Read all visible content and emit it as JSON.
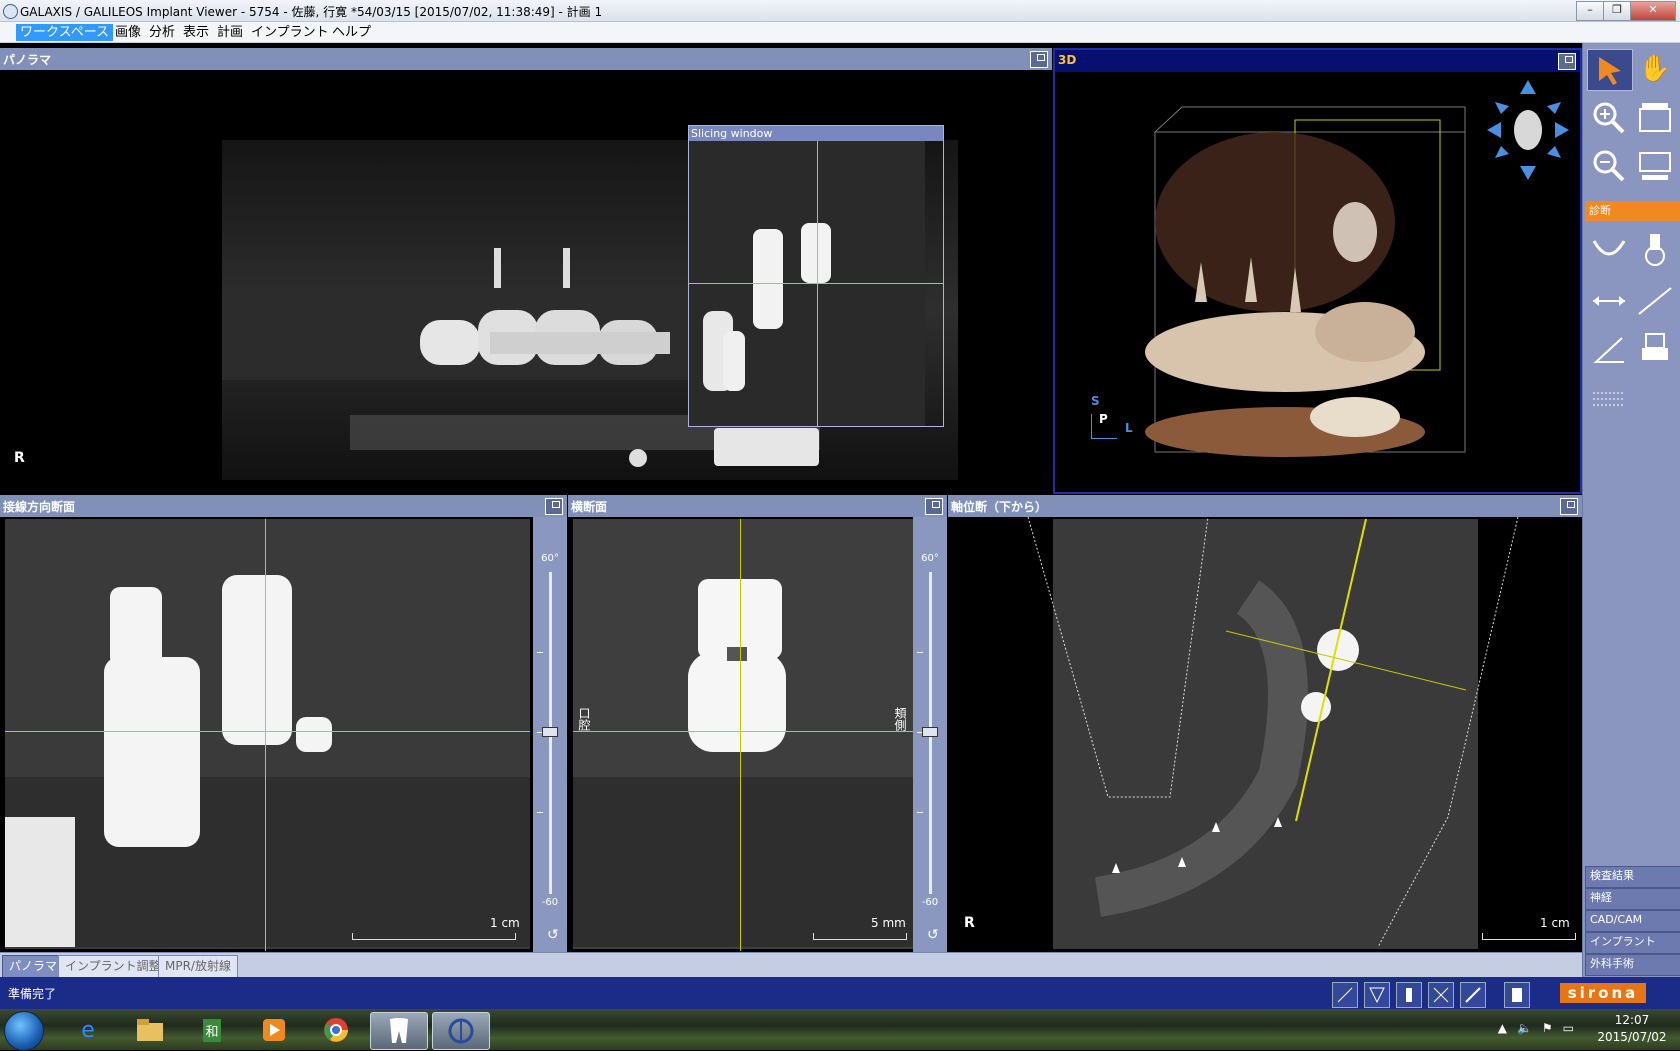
{
  "window": {
    "title": "GALAXIS / GALILEOS Implant Viewer - 5754 - 佐藤, 行寛 *54/03/15 [2015/07/02, 11:38:49] - 計画 1",
    "minimize": "–",
    "restore": "❐",
    "close": "✕"
  },
  "menu": [
    "ワークスペース",
    "画像",
    "分析",
    "表示",
    "計画",
    "インプラント",
    "ヘルプ"
  ],
  "panes": {
    "panorama": {
      "title": "パノラマ",
      "orientation": "R",
      "slicing_window": "Slicing window"
    },
    "view3d": {
      "title": "3D",
      "axis_s": "S",
      "axis_p": "P",
      "axis_l": "L"
    },
    "tangential": {
      "title": "接線方向断面",
      "scale": "1 cm",
      "slider_top": "60°",
      "slider_bottom": "-60"
    },
    "cross": {
      "title": "横断面",
      "scale": "5 mm",
      "label_left": "口腔",
      "label_right": "頬側",
      "slider_top": "60°",
      "slider_bottom": "-60"
    },
    "axial": {
      "title": "軸位断（下から）",
      "orientation": "R",
      "scale": "1 cm"
    }
  },
  "toolbar": {
    "diag_label": "診断",
    "side_buttons": [
      "検査結果",
      "神経",
      "CAD/CAM",
      "インプラント",
      "外科手術"
    ]
  },
  "tabs": [
    "パノラマ",
    "インプラント調整",
    "MPR/放射線"
  ],
  "status": {
    "text": "準備完了",
    "brand": "sirona"
  },
  "taskbar": {
    "time": "12:07",
    "date": "2015/07/02",
    "ime_label": "和"
  },
  "colors": {
    "pane_header": "#8090b8",
    "active_pane_header": "#06106e",
    "crosshair": "#c8c800",
    "accent_orange": "#f08a20",
    "statusbar": "#1b2b88"
  }
}
